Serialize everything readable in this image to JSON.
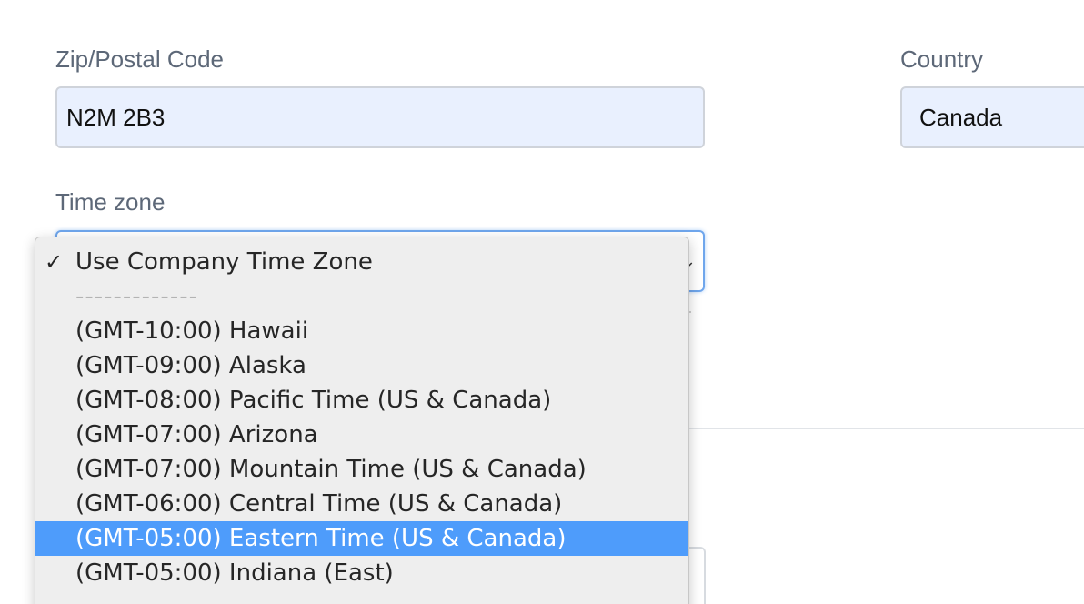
{
  "zip": {
    "label": "Zip/Postal Code",
    "value": "N2M 2B3"
  },
  "country": {
    "label": "Country",
    "value": "Canada"
  },
  "timezone": {
    "label": "Time zone",
    "options": [
      {
        "label": "Use Company Time Zone",
        "checked": true
      },
      {
        "label": "-------------",
        "separator": true
      },
      {
        "label": "(GMT-10:00) Hawaii"
      },
      {
        "label": "(GMT-09:00) Alaska"
      },
      {
        "label": "(GMT-08:00) Pacific Time (US & Canada)"
      },
      {
        "label": "(GMT-07:00) Arizona"
      },
      {
        "label": "(GMT-07:00) Mountain Time (US & Canada)"
      },
      {
        "label": "(GMT-06:00) Central Time (US & Canada)"
      },
      {
        "label": "(GMT-05:00) Eastern Time (US & Canada)",
        "highlighted": true
      },
      {
        "label": "(GMT-05:00) Indiana (East)"
      }
    ],
    "highlight_color": "#4e9cfb"
  },
  "icons": {
    "checkmark": "checkmark-icon",
    "select_arrow": "chevron-down-icon"
  }
}
